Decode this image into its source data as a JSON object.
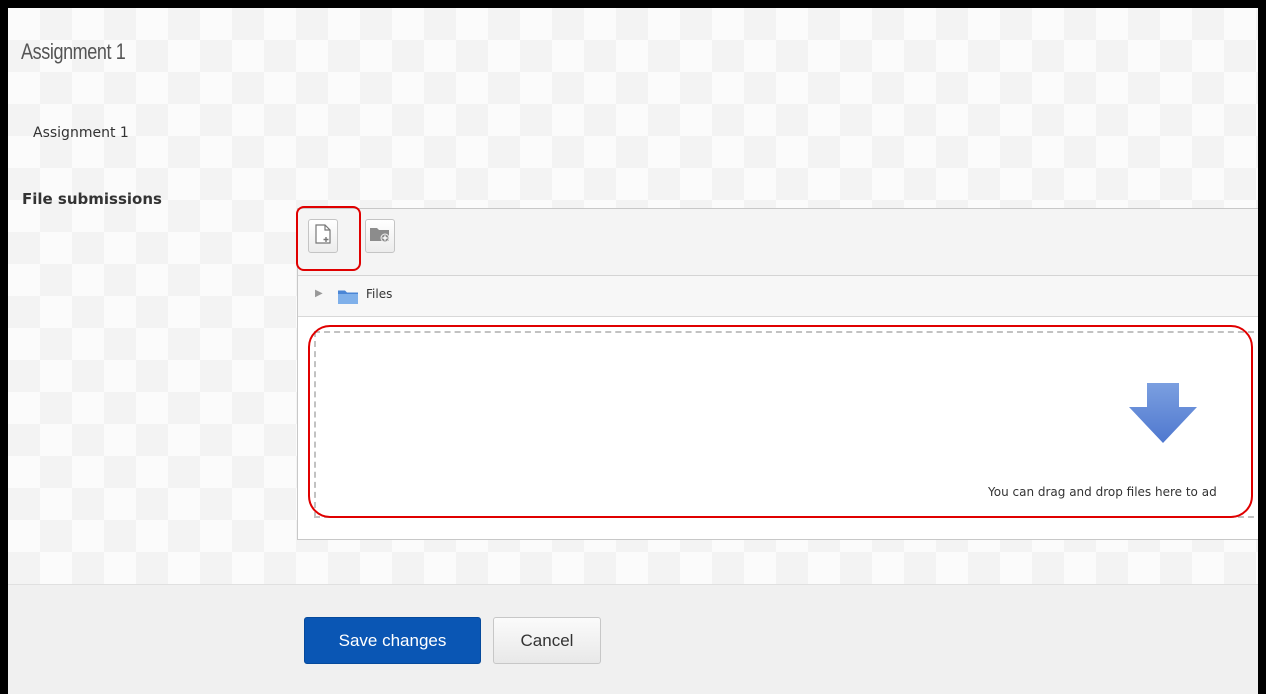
{
  "assignment": {
    "title": "Assignment 1",
    "description": "Assignment 1"
  },
  "submission": {
    "label": "File submissions",
    "toolbar": {
      "add_icon": "file-add-icon",
      "folder_icon": "folder-add-icon"
    },
    "path": {
      "folder_label": "Files",
      "expand_icon": "triangle-right-icon",
      "folder_icon": "folder-icon"
    },
    "dropzone": {
      "text": "You can drag and drop files here to ad",
      "icon": "down-arrow-icon"
    }
  },
  "actions": {
    "save_label": "Save changes",
    "cancel_label": "Cancel"
  },
  "colors": {
    "primary": "#0a56b4",
    "highlight": "#e00000",
    "folder": "#4a86d6",
    "drop_arrow": "#6a8fd8"
  }
}
